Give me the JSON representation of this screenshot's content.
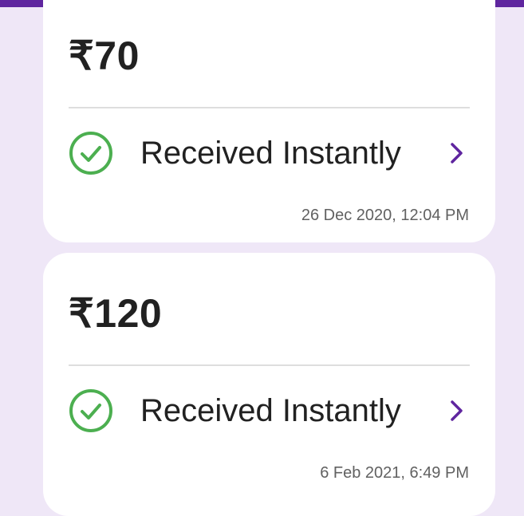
{
  "colors": {
    "background": "#efe7f7",
    "brand": "#5f259f",
    "success": "#4caf50",
    "card": "#ffffff"
  },
  "transactions": [
    {
      "amount": "₹70",
      "status": "Received Instantly",
      "status_icon": "check-circle-icon",
      "action_icon": "chevron-right-icon",
      "timestamp": "26 Dec 2020, 12:04 PM"
    },
    {
      "amount": "₹120",
      "status": "Received Instantly",
      "status_icon": "check-circle-icon",
      "action_icon": "chevron-right-icon",
      "timestamp": "6 Feb 2021, 6:49 PM"
    }
  ]
}
